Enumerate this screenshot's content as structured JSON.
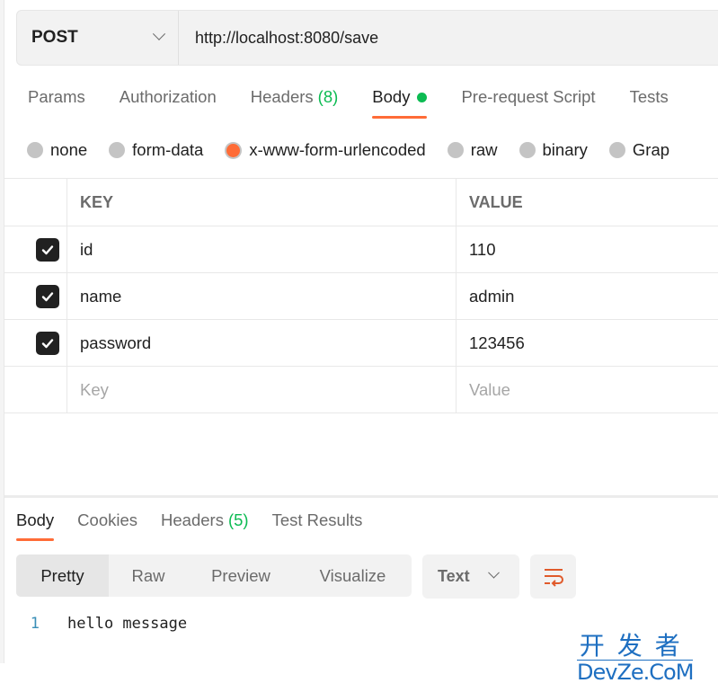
{
  "request": {
    "method": "POST",
    "url": "http://localhost:8080/save",
    "tabs": [
      {
        "label": "Params",
        "count": null,
        "active": false
      },
      {
        "label": "Authorization",
        "count": null,
        "active": false
      },
      {
        "label": "Headers",
        "count": "(8)",
        "active": false
      },
      {
        "label": "Body",
        "count": null,
        "active": true,
        "dot": true
      },
      {
        "label": "Pre-request Script",
        "count": null,
        "active": false
      },
      {
        "label": "Tests",
        "count": null,
        "active": false
      }
    ],
    "body_types": [
      {
        "label": "none",
        "checked": false
      },
      {
        "label": "form-data",
        "checked": false
      },
      {
        "label": "x-www-form-urlencoded",
        "checked": true
      },
      {
        "label": "raw",
        "checked": false
      },
      {
        "label": "binary",
        "checked": false
      },
      {
        "label": "Grap",
        "checked": false
      }
    ],
    "table": {
      "headers": {
        "key": "KEY",
        "value": "VALUE"
      },
      "rows": [
        {
          "checked": true,
          "key": "id",
          "value": "110"
        },
        {
          "checked": true,
          "key": "name",
          "value": "admin"
        },
        {
          "checked": true,
          "key": "password",
          "value": "123456"
        }
      ],
      "placeholder": {
        "key": "Key",
        "value": "Value"
      }
    }
  },
  "response": {
    "tabs": [
      {
        "label": "Body",
        "count": null,
        "active": true
      },
      {
        "label": "Cookies",
        "count": null,
        "active": false
      },
      {
        "label": "Headers",
        "count": "(5)",
        "active": false
      },
      {
        "label": "Test Results",
        "count": null,
        "active": false
      }
    ],
    "view_modes": [
      "Pretty",
      "Raw",
      "Preview",
      "Visualize"
    ],
    "active_view": "Pretty",
    "format": "Text",
    "code_lines": [
      {
        "line": "1",
        "text": "hello message"
      }
    ]
  },
  "watermark": {
    "cn": "开发者",
    "en": "DevZe.CoM"
  },
  "colors": {
    "accent": "#ff6c37",
    "success": "#0cbb52",
    "watermark": "#1e6fc1"
  }
}
